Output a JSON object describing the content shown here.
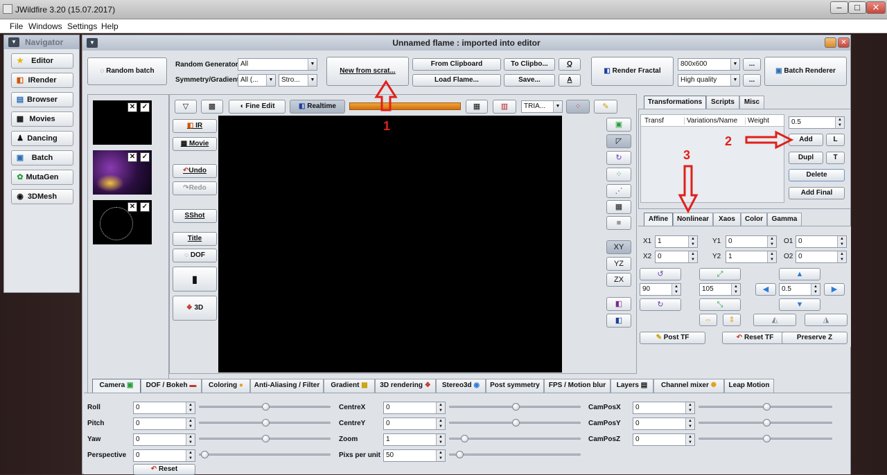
{
  "window": {
    "title": "JWildfire 3.20 (15.07.2017)",
    "minimize": "–",
    "maximize": "□",
    "close": "✕"
  },
  "menu": [
    "File",
    "Windows",
    "Settings",
    "Help"
  ],
  "navigator": {
    "title": "Navigator",
    "items": [
      {
        "label": "Editor",
        "icon": "★"
      },
      {
        "label": "IRender",
        "icon": "◧"
      },
      {
        "label": "Browser",
        "icon": "▤"
      },
      {
        "label": "Movies",
        "icon": "▦"
      },
      {
        "label": "Dancing",
        "icon": "🕺"
      },
      {
        "label": "Batch",
        "icon": "▣"
      },
      {
        "label": "MutaGen",
        "icon": "✿"
      },
      {
        "label": "3DMesh",
        "icon": "◉"
      }
    ]
  },
  "editor": {
    "title": "Unnamed flame : imported into editor",
    "toolbar": {
      "random_batch": "Random batch",
      "random_generator_label": "Random Generator",
      "random_generator_value": "All",
      "symmetry_label": "Symmetry/Gradient",
      "symmetry_value": "All (...",
      "stro_value": "Stro...",
      "new_from_scratch": "New from scrat...",
      "from_clipboard": "From Clipboard",
      "to_clipboard": "To Clipbo...",
      "q": "Q",
      "load_flame": "Load Flame...",
      "save": "Save...",
      "a": "A",
      "render_fractal": "Render Fractal",
      "resolution": "800x600",
      "quality": "High quality",
      "more1": "...",
      "more2": "...",
      "batch_renderer": "Batch Renderer"
    },
    "preview_bar": {
      "fine_edit": "Fine Edit",
      "realtime": "Realtime",
      "mode": "TRIA..."
    },
    "left_tools": {
      "ir": "IR",
      "movie": "Movie",
      "undo": "Undo",
      "redo": "Redo",
      "sshot": "SShot",
      "title": "Title",
      "dof": "DOF",
      "three_d": "3D"
    },
    "right_tools": {
      "xy": "XY",
      "yz": "YZ",
      "zx": "ZX"
    },
    "thumbs": {
      "close": "✕",
      "check": "✓"
    },
    "transforms": {
      "tabs": [
        "Transformations",
        "Scripts",
        "Misc"
      ],
      "columns": [
        "Transf",
        "Variations/Name",
        "Weight"
      ],
      "weight_value": "0.5",
      "add": "Add",
      "l": "L",
      "dupl": "Dupl",
      "t": "T",
      "delete": "Delete",
      "add_final": "Add Final"
    },
    "affine": {
      "tabs": [
        "Affine",
        "Nonlinear",
        "Xaos",
        "Color",
        "Gamma"
      ],
      "x1_label": "X1",
      "x1": "1",
      "y1_label": "Y1",
      "y1": "0",
      "o1_label": "O1",
      "o1": "0",
      "x2_label": "X2",
      "x2": "0",
      "y2_label": "Y2",
      "y2": "1",
      "o2_label": "O2",
      "o2": "0",
      "rotate_value": "90",
      "scale_value": "105",
      "move_value": "0.5",
      "post_tf": "Post TF",
      "reset_tf": "Reset TF",
      "preserve_z": "Preserve Z"
    },
    "bottom_tabs": [
      "Camera",
      "DOF / Bokeh",
      "Coloring",
      "Anti-Aliasing / Filter",
      "Gradient",
      "3D rendering",
      "Stereo3d",
      "Post symmetry",
      "FPS / Motion blur",
      "Layers",
      "Channel mixer",
      "Leap Motion"
    ],
    "camera": {
      "roll_label": "Roll",
      "roll": "0",
      "pitch_label": "Pitch",
      "pitch": "0",
      "yaw_label": "Yaw",
      "yaw": "0",
      "perspective_label": "Perspective",
      "perspective": "0",
      "centrex_label": "CentreX",
      "centrex": "0",
      "centrey_label": "CentreY",
      "centrey": "0",
      "zoom_label": "Zoom",
      "zoom": "1",
      "pix_label": "Pixs per unit",
      "pix": "50",
      "camposx_label": "CamPosX",
      "camposx": "0",
      "camposy_label": "CamPosY",
      "camposy": "0",
      "camposz_label": "CamPosZ",
      "camposz": "0",
      "reset": "Reset"
    }
  },
  "annotations": {
    "n1": "1",
    "n2": "2",
    "n3": "3",
    "arrow_color": "#e0201a"
  }
}
